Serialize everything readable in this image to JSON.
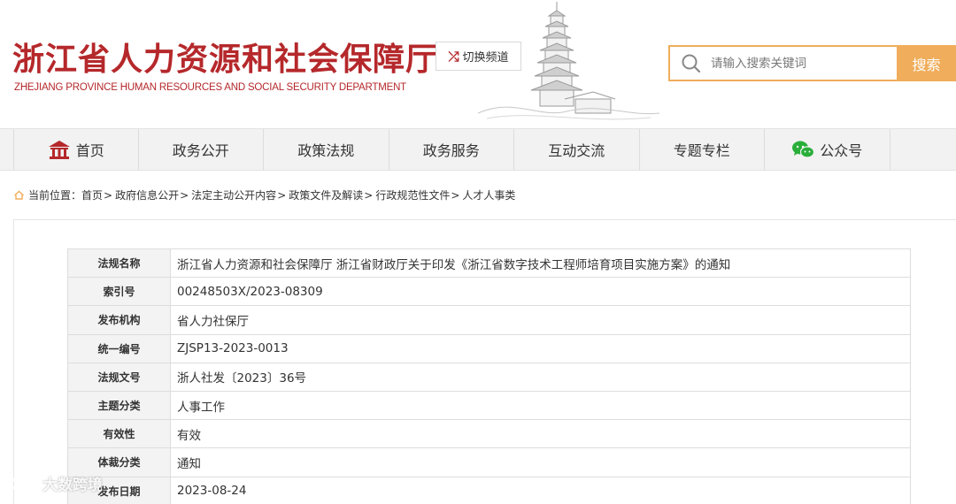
{
  "header": {
    "title": "浙江省人力资源和社会保障厅",
    "subtitle": "ZHEJIANG PROVINCE HUMAN RESOURCES AND SOCIAL SECURITY DEPARTMENT",
    "switch_label": "切换频道",
    "search_placeholder": "请输入搜索关键词",
    "search_button": "搜索"
  },
  "nav": {
    "items": [
      "首页",
      "政务公开",
      "政策法规",
      "政务服务",
      "互动交流",
      "专题专栏",
      "公众号"
    ]
  },
  "breadcrumb": {
    "prefix": "当前位置：",
    "items": [
      "首页",
      "政府信息公开",
      "法定主动公开内容",
      "政策文件及解读",
      "行政规范性文件",
      "人才人事类"
    ]
  },
  "meta": {
    "rows": [
      {
        "key": "法规名称",
        "value": "浙江省人力资源和社会保障厅 浙江省财政厅关于印发《浙江省数字技术工程师培育项目实施方案》的通知"
      },
      {
        "key": "索引号",
        "value": "00248503X/2023-08309"
      },
      {
        "key": "发布机构",
        "value": "省人力社保厅"
      },
      {
        "key": "统一编号",
        "value": "ZJSP13-2023-0013"
      },
      {
        "key": "法规文号",
        "value": "浙人社发〔2023〕36号"
      },
      {
        "key": "主题分类",
        "value": "人事工作"
      },
      {
        "key": "有效性",
        "value": "有效"
      },
      {
        "key": "体裁分类",
        "value": "通知"
      },
      {
        "key": "发布日期",
        "value": "2023-08-24"
      }
    ]
  },
  "watermark": "大数跨境",
  "colors": {
    "brand": "#b5282b",
    "accent": "#f0ad5b",
    "nav_bg": "#f2f2f2"
  }
}
